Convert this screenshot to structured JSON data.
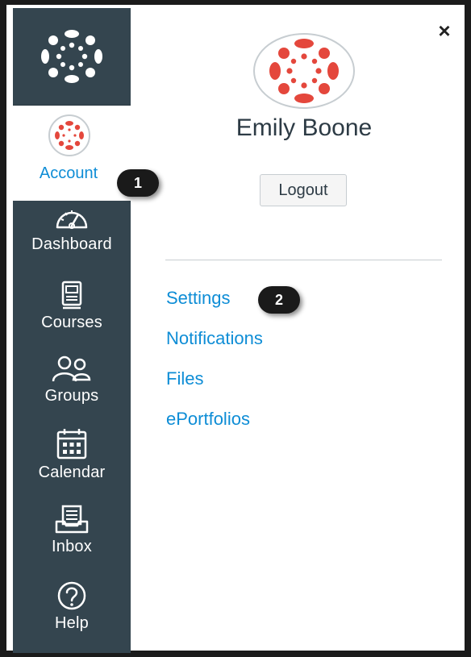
{
  "colors": {
    "sidebar_bg": "#34454f",
    "link": "#0e8dd6",
    "brand_red": "#e4473c",
    "badge_bg": "#1a1a1a"
  },
  "sidebar": {
    "logo_icon": "canvas-logo-icon",
    "account": {
      "label": "Account",
      "icon": "avatar-icon"
    },
    "items": [
      {
        "label": "Dashboard",
        "icon": "dashboard-icon"
      },
      {
        "label": "Courses",
        "icon": "courses-icon"
      },
      {
        "label": "Groups",
        "icon": "groups-icon"
      },
      {
        "label": "Calendar",
        "icon": "calendar-icon"
      },
      {
        "label": "Inbox",
        "icon": "inbox-icon"
      },
      {
        "label": "Help",
        "icon": "help-icon"
      }
    ]
  },
  "tray": {
    "close_glyph": "×",
    "user_name": "Emily Boone",
    "logout_label": "Logout",
    "links": [
      "Settings",
      "Notifications",
      "Files",
      "ePortfolios"
    ]
  },
  "badges": {
    "step1": "1",
    "step2": "2"
  }
}
